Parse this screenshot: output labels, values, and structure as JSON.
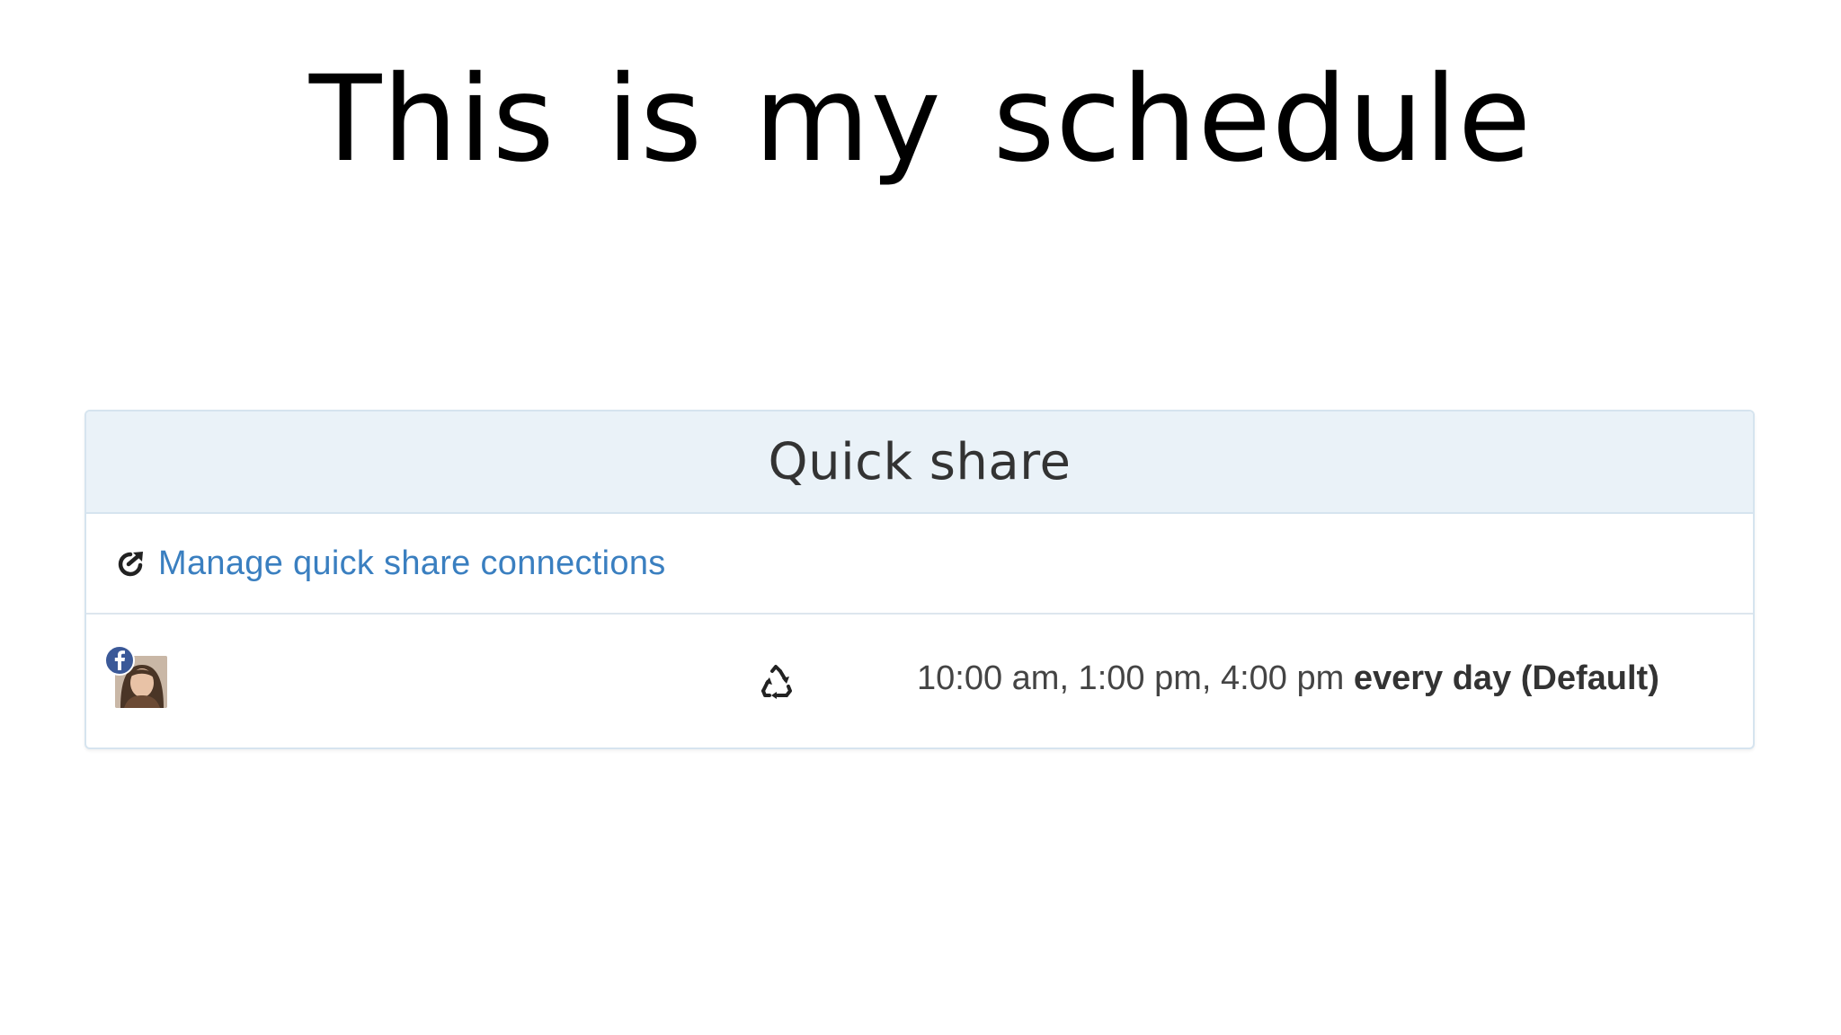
{
  "slide": {
    "title": "This is my schedule"
  },
  "panel": {
    "header_title": "Quick share",
    "manage_link": "Manage quick share connections",
    "account": {
      "network": "facebook",
      "schedule_times": "10:00 am, 1:00 pm, 4:00 pm",
      "schedule_frequency": "every day (Default)"
    }
  },
  "icons": {
    "manage": "share-out-icon",
    "network_badge": "facebook-icon",
    "repeat": "recycle-icon"
  },
  "colors": {
    "header_bg": "#eaf2f8",
    "border": "#d6e4ef",
    "link": "#3a7fc0",
    "facebook": "#3b5998"
  }
}
